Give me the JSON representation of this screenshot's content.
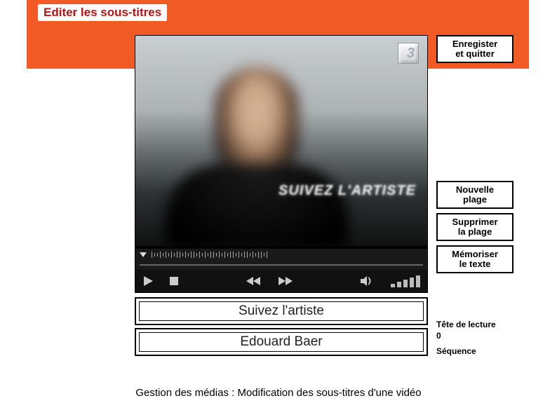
{
  "header": {
    "title": "Editer les sous-titres"
  },
  "video": {
    "channel_logo": "3",
    "overlay": "SUIVEZ L'ARTISTE"
  },
  "subtitles": {
    "line1": "Suivez l'artiste",
    "line2": "Edouard Baer"
  },
  "buttons": {
    "save_quit_l1": "Enregister",
    "save_quit_l2": "et quitter",
    "new_range_l1": "Nouvelle",
    "new_range_l2": "plage",
    "del_range_l1": "Supprimer",
    "del_range_l2": "la plage",
    "mem_text_l1": "Mémoriser",
    "mem_text_l2": "le texte"
  },
  "info": {
    "playhead_label": "Tête de lecture",
    "playhead_value": "0",
    "sequence_label": "Séquence"
  },
  "caption": "Gestion des médias : Modification des sous-titres d'une vidéo"
}
